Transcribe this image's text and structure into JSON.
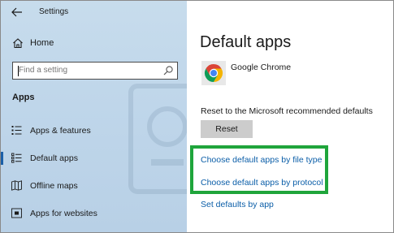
{
  "window": {
    "title": "Settings"
  },
  "sidebar": {
    "home_label": "Home",
    "search": {
      "placeholder": "Find a setting"
    },
    "section_title": "Apps",
    "items": [
      {
        "label": "Apps & features",
        "icon": "apps-features-icon",
        "selected": false
      },
      {
        "label": "Default apps",
        "icon": "default-apps-icon",
        "selected": true
      },
      {
        "label": "Offline maps",
        "icon": "offline-maps-icon",
        "selected": false
      },
      {
        "label": "Apps for websites",
        "icon": "apps-for-websites-icon",
        "selected": false
      }
    ]
  },
  "main": {
    "title": "Default apps",
    "browser": {
      "name": "Google Chrome",
      "icon": "chrome-icon"
    },
    "reset_text": "Reset to the Microsoft recommended defaults",
    "reset_button": "Reset",
    "links": [
      "Choose default apps by file type",
      "Choose default apps by protocol",
      "Set defaults by app"
    ]
  },
  "colors": {
    "sidebar_bg": "#c0d7ea",
    "accent": "#1a5fa8",
    "link": "#0b5ea8",
    "highlight": "#1fa53b",
    "button_bg": "#cccccc"
  }
}
